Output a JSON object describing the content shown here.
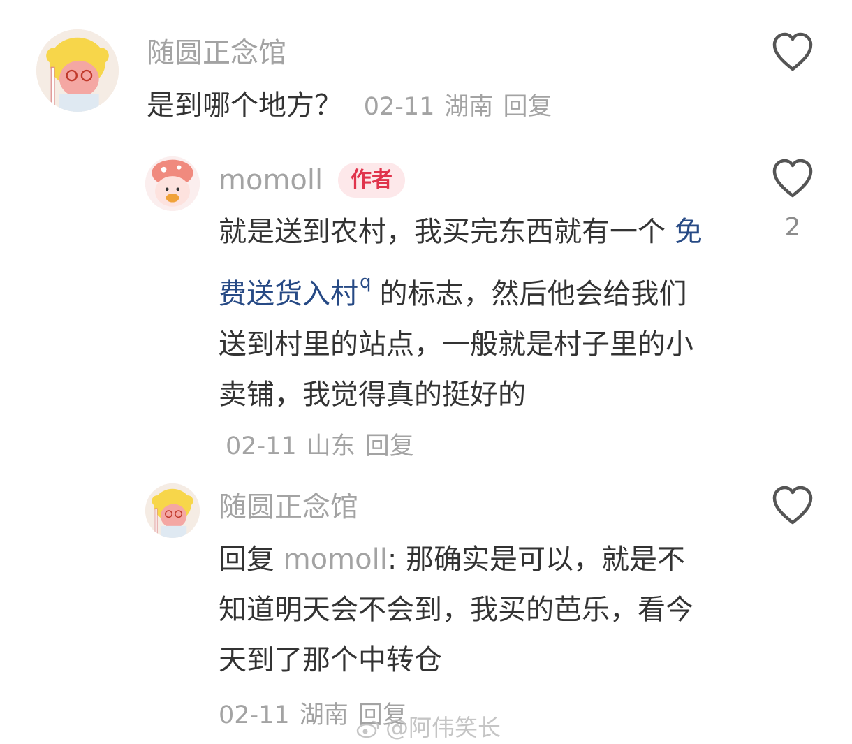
{
  "comments": [
    {
      "username": "随圆正念馆",
      "text": "是到哪个地方？",
      "date": "02-11",
      "location": "湖南",
      "reply_label": "回复",
      "likes": ""
    }
  ],
  "replies": [
    {
      "username": "momoll",
      "badge": "作者",
      "text_before_link": "就是送到农村，我买完东西就有一个 ",
      "link_text": "免费送货入村",
      "link_icon": "search-icon",
      "text_after_link": "的标志，然后他会给我们送到村里的站点，一般就是村子里的小卖铺，我觉得真的挺好的",
      "date": "02-11",
      "location": "山东",
      "reply_label": "回复",
      "likes": "2"
    },
    {
      "username": "随圆正念馆",
      "reply_prefix": "回复 ",
      "mention": "momoll",
      "mention_sep": ": ",
      "text": "那确实是可以，就是不知道明天会不会到，我买的芭乐，看今天到了那个中转仓",
      "date": "02-11",
      "location": "湖南",
      "reply_label": "回复",
      "likes": ""
    }
  ],
  "watermark": {
    "text": "@阿伟笑长",
    "icon": "weibo-icon"
  },
  "colors": {
    "username": "#a3a3a3",
    "text": "#333333",
    "link": "#274a85",
    "badge_bg": "#fde8ea",
    "badge_text": "#e0344c"
  }
}
